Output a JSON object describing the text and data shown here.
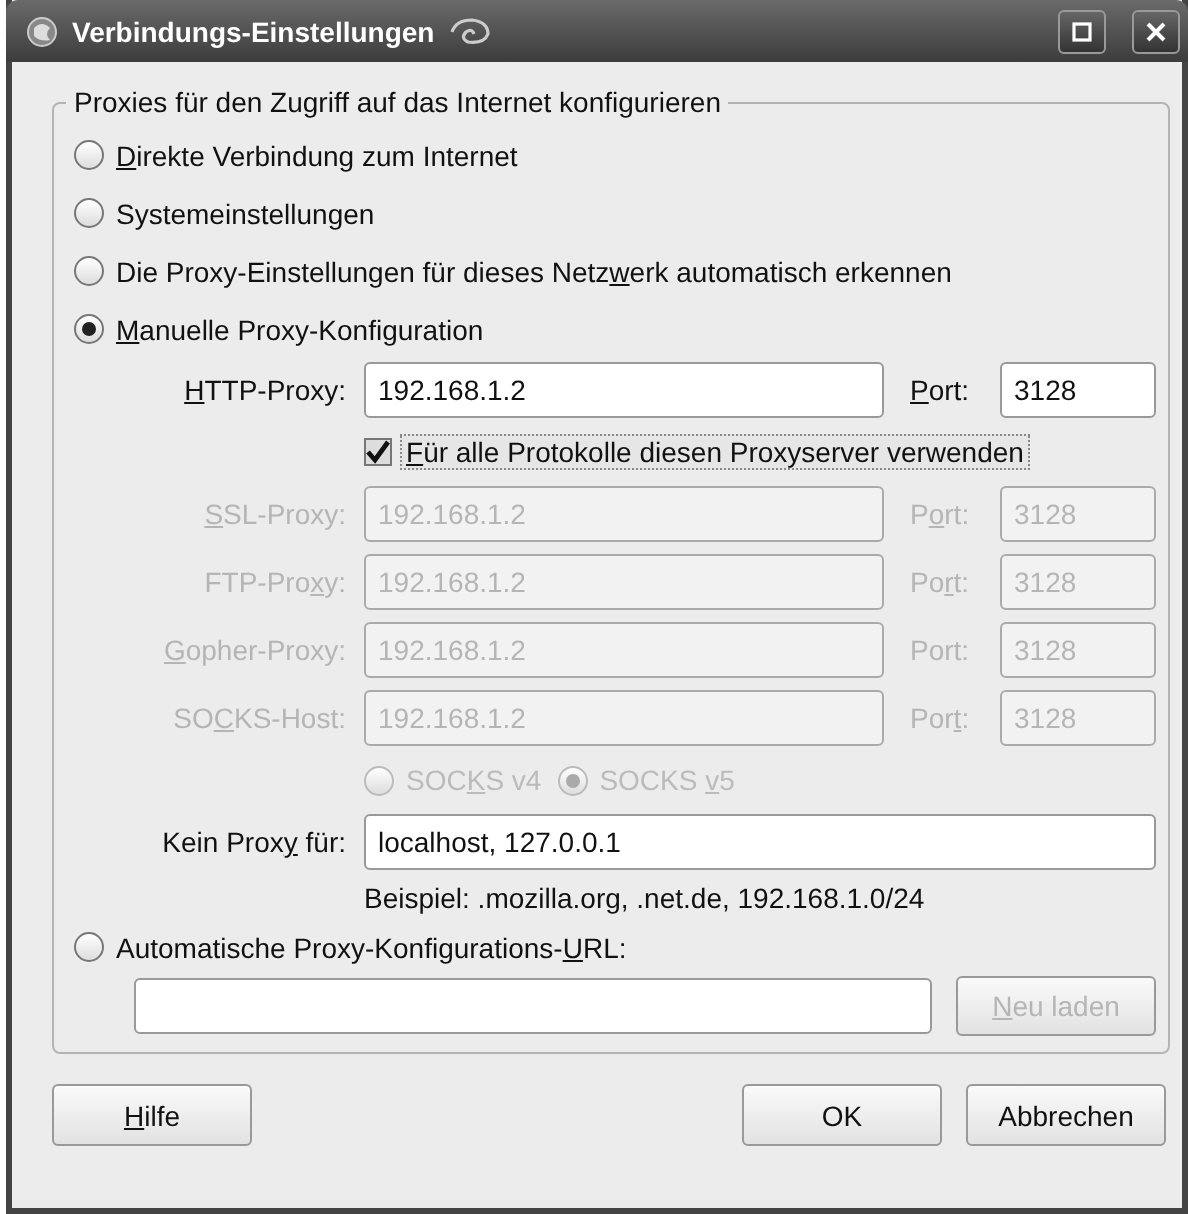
{
  "window": {
    "title": "Verbindungs-Einstellungen"
  },
  "group": {
    "title": "Proxies für den Zugriff auf das Internet konfigurieren"
  },
  "modes": [
    {
      "label": {
        "key": "D",
        "after": "irekte Verbindung zum Internet"
      },
      "selected": false
    },
    {
      "label": {
        "before": "Systemeinstellungen"
      },
      "selected": false
    },
    {
      "label": {
        "before": "Die Proxy-Einstellungen für dieses Netz",
        "key": "w",
        "after": "erk automatisch erkennen"
      },
      "selected": false
    },
    {
      "label": {
        "key": "M",
        "after": "anuelle Proxy-Konfiguration"
      },
      "selected": true
    }
  ],
  "proxies": [
    {
      "label": {
        "key": "H",
        "after": "TTP-Proxy:"
      },
      "value": "192.168.1.2",
      "port_label": {
        "key": "P",
        "after": "ort:"
      },
      "port": "3128",
      "disabled": false
    },
    {
      "label": {
        "key": "S",
        "after": "SL-Proxy:"
      },
      "value": "192.168.1.2",
      "port_label": {
        "before": "P",
        "key": "o",
        "after": "rt:"
      },
      "port": "3128",
      "disabled": true
    },
    {
      "label": {
        "before": "FTP-Pro",
        "key": "x",
        "after": "y:"
      },
      "value": "192.168.1.2",
      "port_label": {
        "before": "Po",
        "key": "r",
        "after": "t:"
      },
      "port": "3128",
      "disabled": true
    },
    {
      "label": {
        "key": "G",
        "after": "opher-Proxy:"
      },
      "value": "192.168.1.2",
      "port_label": {
        "before": "Port:"
      },
      "port": "3128",
      "disabled": true
    },
    {
      "label": {
        "before": "SO",
        "key": "C",
        "after": "KS-Host:"
      },
      "value": "192.168.1.2",
      "port_label": {
        "before": "Por",
        "key": "t",
        "after": ":"
      },
      "port": "3128",
      "disabled": true
    }
  ],
  "share_all": {
    "label": {
      "key": "F",
      "after": "ür alle Protokolle diesen Proxyserver verwenden"
    },
    "checked": true
  },
  "socks_versions": [
    {
      "label": {
        "before": "SOC",
        "key": "K",
        "after": "S v4"
      },
      "selected": false,
      "disabled": true
    },
    {
      "label": {
        "before": "SOCKS ",
        "key": "v",
        "after": "5"
      },
      "selected": true,
      "disabled": true
    }
  ],
  "no_proxy": {
    "label": {
      "before": "Kein Prox",
      "key": "y",
      "after": " für:"
    },
    "value": "localhost, 127.0.0.1",
    "hint": "Beispiel: .mozilla.org, .net.de, 192.168.1.0/24"
  },
  "auto_config": {
    "label": {
      "before": "Automatische Proxy-Konfigurations-",
      "key": "U",
      "after": "RL:"
    },
    "selected": false,
    "reload": {
      "label": {
        "key": "N",
        "after": "eu laden"
      },
      "disabled": true
    }
  },
  "buttons": [
    {
      "label": {
        "key": "H",
        "after": "ilfe"
      },
      "kind": "help"
    },
    {
      "label": {
        "before": "OK"
      },
      "kind": "ok"
    },
    {
      "label": {
        "before": "Abbrechen"
      },
      "kind": "cancel"
    }
  ]
}
